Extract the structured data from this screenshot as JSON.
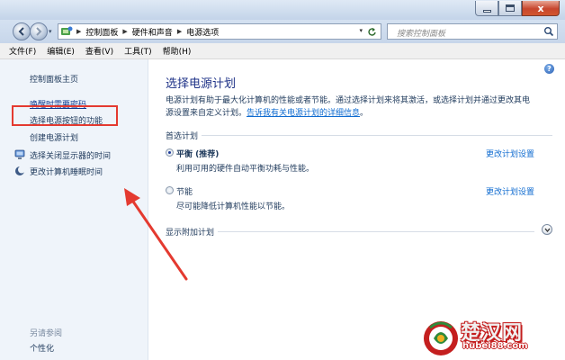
{
  "window": {
    "close_label": "x",
    "colors": {
      "close_red": "#c7462e",
      "frame": "#c7d6ea"
    }
  },
  "address": {
    "icon": "control-panel-icon",
    "crumbs": [
      "控制面板",
      "硬件和声音",
      "电源选项"
    ],
    "search_placeholder": "搜索控制面板"
  },
  "menu": {
    "items": [
      "文件(F)",
      "编辑(E)",
      "查看(V)",
      "工具(T)",
      "帮助(H)"
    ]
  },
  "sidebar": {
    "home": "控制面板主页",
    "items": [
      {
        "label": "唤醒时需要密码",
        "icon": ""
      },
      {
        "label": "选择电源按钮的功能",
        "icon": ""
      },
      {
        "label": "创建电源计划",
        "icon": ""
      },
      {
        "label": "选择关闭显示器的时间",
        "icon": "monitor-icon"
      },
      {
        "label": "更改计算机睡眠时间",
        "icon": "moon-icon"
      }
    ],
    "see_also": "另请参阅",
    "personalize": "个性化"
  },
  "main": {
    "help": "?",
    "title": "选择电源计划",
    "desc_line1": "电源计划有助于最大化计算机的性能或者节能。通过选择计划来将其激活，或选择计划并通过更改其电",
    "desc_line2": "源设置来自定义计划。",
    "desc_link": "告诉我有关电源计划的详细信息",
    "desc_end": "。",
    "preferred_group": "首选计划",
    "plans": [
      {
        "name": "平衡 (推荐)",
        "desc": "利用可用的硬件自动平衡功耗与性能。",
        "link": "更改计划设置",
        "selected": true
      },
      {
        "name": "节能",
        "desc": "尽可能降低计算机性能以节能。",
        "link": "更改计划设置",
        "selected": false
      }
    ],
    "extra_group": "显示附加计划"
  },
  "watermark": {
    "title": "楚汉网",
    "url": "hubei88.com"
  },
  "annotation": {
    "color": "#e43a30"
  }
}
